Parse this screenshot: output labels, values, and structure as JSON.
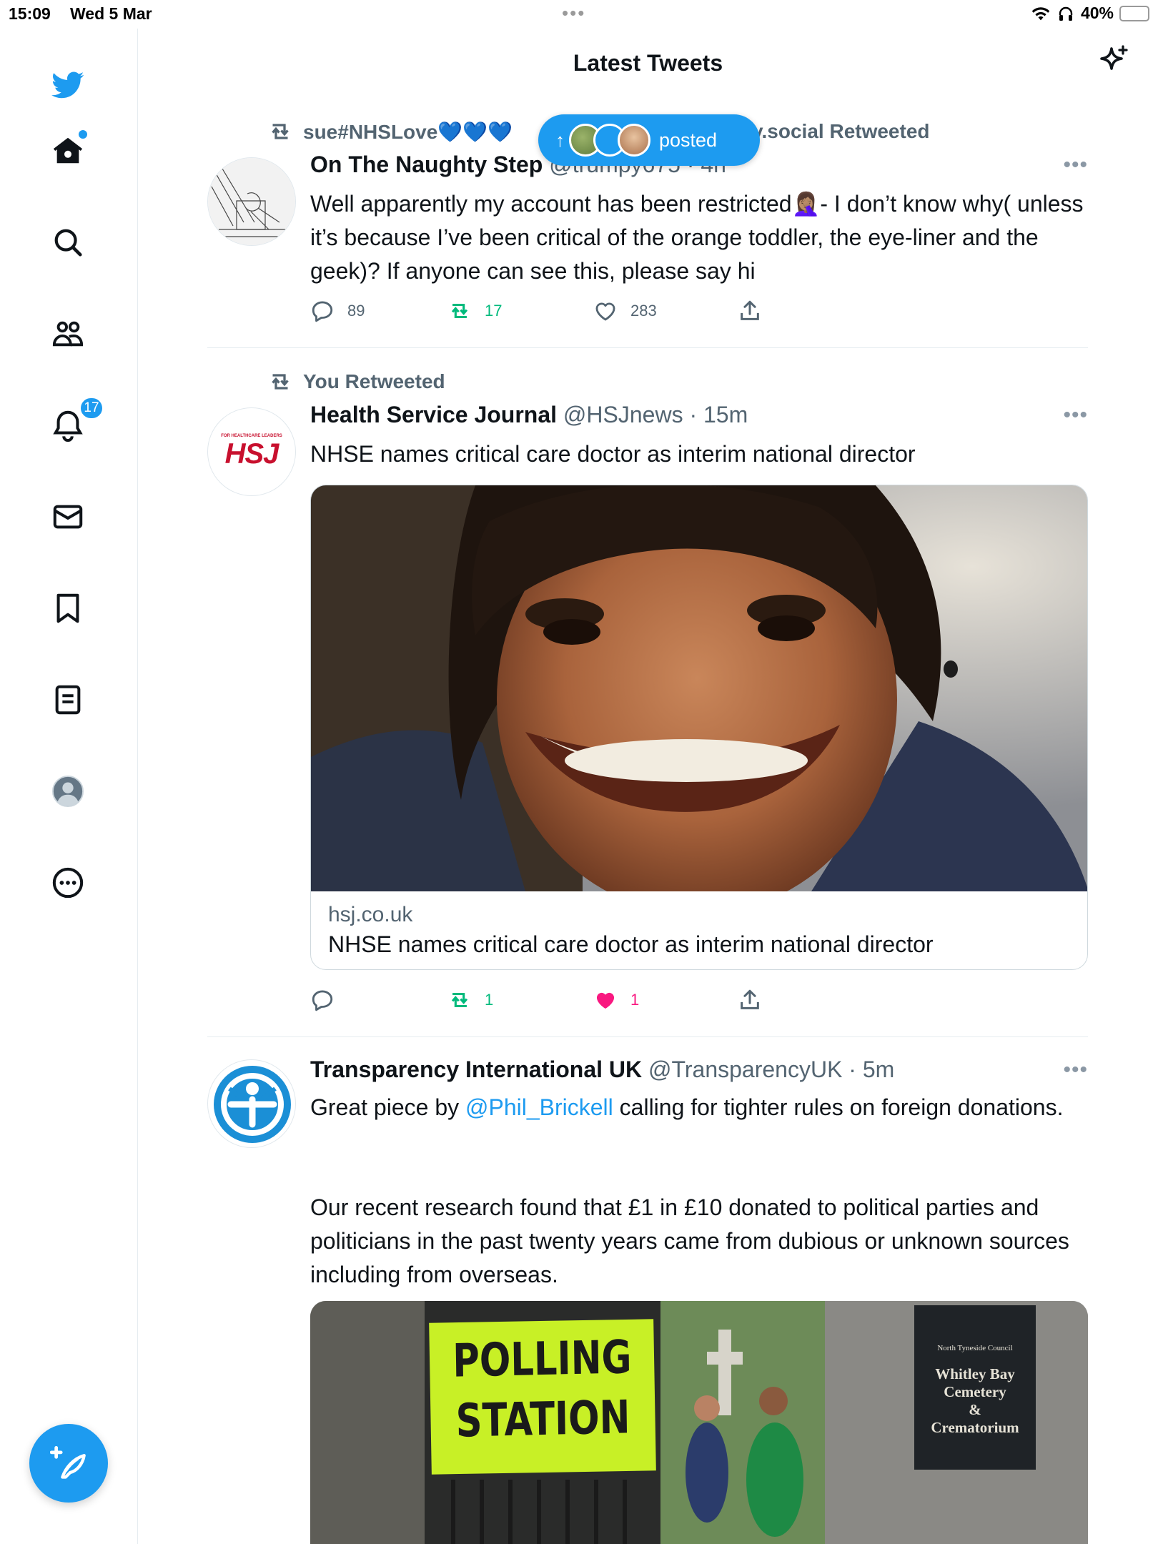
{
  "status_bar": {
    "time": "15:09",
    "date": "Wed 5 Mar",
    "battery": "40%",
    "battery_level": 0.4
  },
  "header": {
    "title": "Latest Tweets"
  },
  "sidebar": {
    "notifications_badge": "17"
  },
  "pill": {
    "arrow": "↑",
    "label": "posted"
  },
  "tweets": [
    {
      "retweet_by": "sue#NHSLove💙💙💙",
      "retweet_suffix": "sky.social Retweeted",
      "name": "On The Naughty Step",
      "handle": "@trumpy675 · 4h",
      "text": "Well apparently my account has been restricted🤦🏽‍♀️- I don’t know why( unless it’s because I’ve been critical of the orange toddler, the eye-liner and the geek)? If anyone can see this, please say hi",
      "replies": "89",
      "retweets": "17",
      "likes": "283"
    },
    {
      "retweet_line": "You Retweeted",
      "name": "Health Service Journal",
      "handle": "@HSJnews · 15m",
      "avatar_label": "HSJ",
      "avatar_sub": "FOR HEALTHCARE LEADERS",
      "text": "NHSE names critical care doctor as interim national director",
      "card_domain": "hsj.co.uk",
      "card_title": "NHSE names critical care doctor as interim national director",
      "replies": "",
      "retweets": "1",
      "likes": "1"
    },
    {
      "name": "Transparency International UK",
      "handle": "@TransparencyUK · 5m",
      "text_pre": "Great piece by ",
      "mention": "@Phil_Brickell",
      "text_post": " calling for tighter rules on foreign donations.",
      "text2": "Our recent research found that £1 in £10 donated to political parties and politicians in the past twenty years came from dubious or unknown sources including from overseas.",
      "media_sign1": "POLLING",
      "media_sign2": "STATION",
      "media_council": "North Tyneside Council",
      "media_cemetery1": "Whitley Bay",
      "media_cemetery2": "Cemetery",
      "media_cemetery3": "&",
      "media_cemetery4": "Crematorium"
    }
  ],
  "colors": {
    "accent": "#1d9bf0",
    "retweet_green": "#00ba7c",
    "like_pink": "#f91880",
    "muted": "#536471"
  }
}
